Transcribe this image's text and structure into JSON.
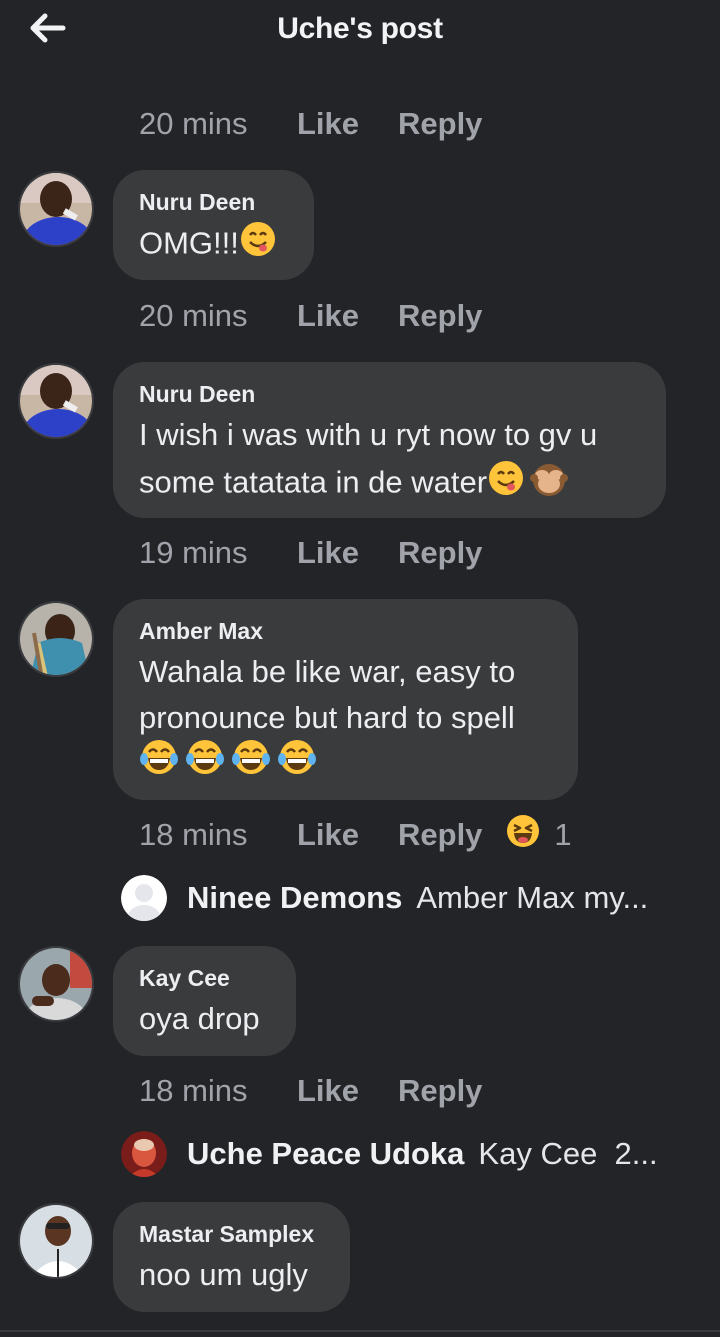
{
  "header": {
    "title": "Uche's post",
    "back_icon": "arrow-left-icon"
  },
  "comments": [
    {
      "meta": {
        "time": "20 mins",
        "like": "Like",
        "reply": "Reply"
      }
    },
    {
      "author": "Nuru Deen",
      "text": "OMG!!!",
      "emojis": [
        "face-savoring-food"
      ],
      "meta": {
        "time": "20 mins",
        "like": "Like",
        "reply": "Reply"
      }
    },
    {
      "author": "Nuru Deen",
      "text_line1": "I wish i was with u ryt now to gv u",
      "text_line2": "some tatatata in de water",
      "emojis": [
        "face-savoring-food",
        "see-no-evil-monkey"
      ],
      "meta": {
        "time": "19 mins",
        "like": "Like",
        "reply": "Reply"
      }
    },
    {
      "author": "Amber Max",
      "text_line1": "Wahala be like war, easy to",
      "text_line2": "pronounce but hard to spell",
      "emojis": [
        "tears-of-joy",
        "tears-of-joy",
        "tears-of-joy",
        "tears-of-joy"
      ],
      "meta": {
        "time": "18 mins",
        "like": "Like",
        "reply": "Reply",
        "reaction_icon": "haha-reaction-icon",
        "reaction_count": "1"
      },
      "reply_preview": {
        "name": "Ninee Demons",
        "text": "Amber Max my..."
      }
    },
    {
      "author": "Kay Cee",
      "text": "oya drop",
      "meta": {
        "time": "18 mins",
        "like": "Like",
        "reply": "Reply"
      },
      "reply_preview": {
        "name": "Uche Peace Udoka",
        "text": "Kay Cee  2..."
      }
    },
    {
      "author": "Mastar Samplex",
      "text": "noo um ugly"
    }
  ],
  "colors": {
    "background": "#232427",
    "bubble": "#3a3b3d",
    "meta_text": "#a0a3a9",
    "primary_text": "#eceef1"
  }
}
